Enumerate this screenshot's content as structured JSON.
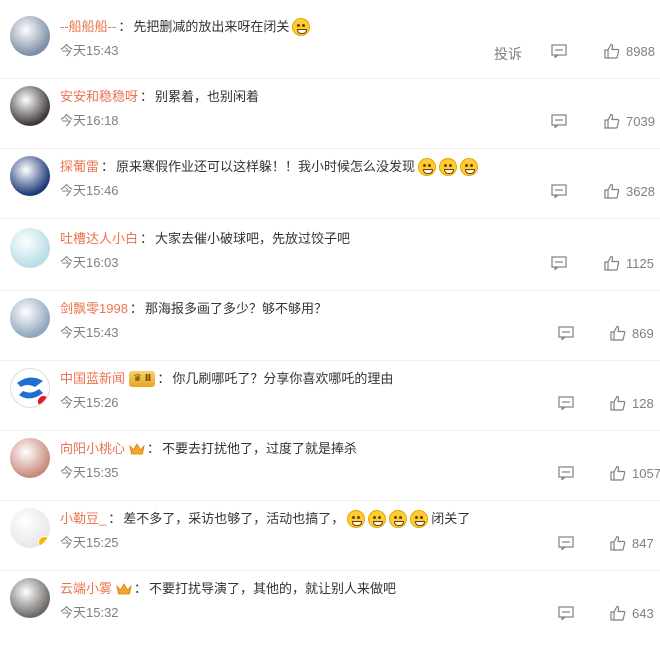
{
  "comments": [
    {
      "username": "--船船船--",
      "text": "先把删减的放出来呀在闭关",
      "time": "今天15:43",
      "likes": "8988",
      "report": "投诉",
      "emojis": 1,
      "avatar_color": "#7c8ea5"
    },
    {
      "username": "安安和稳稳呀",
      "text": "别累着，也别闲着",
      "time": "今天16:18",
      "likes": "7039",
      "emojis": 0,
      "avatar_color": "#3e3a38"
    },
    {
      "username": "探葡雷",
      "text": "原来寒假作业还可以这样躲！！我小时候怎么没发现",
      "time": "今天15:46",
      "likes": "3628",
      "emojis": 3,
      "avatar_color": "#1d3a7a"
    },
    {
      "username": "吐槽达人小白",
      "text": "大家去催小破球吧，先放过饺子吧",
      "time": "今天16:03",
      "likes": "1125",
      "emojis": 0,
      "avatar_color": "#b7dde6"
    },
    {
      "username": "剑飘零1998",
      "text": "那海报多画了多少？够不够用？",
      "time": "今天15:43",
      "likes": "869",
      "emojis": 0,
      "avatar_color": "#8fa6bd"
    },
    {
      "username": "中国蓝新闻",
      "badge": "Ⅱ",
      "text": "你几刷哪吒了？分享你喜欢哪吒的理由",
      "time": "今天15:26",
      "likes": "128",
      "emojis": 0,
      "avatar_color": "#ffffff",
      "verified": true
    },
    {
      "username": "向阳小桃心",
      "crown": true,
      "text": "不要去打扰他了，过度了就是捧杀",
      "time": "今天15:35",
      "likes": "1057",
      "emojis": 0,
      "avatar_color": "#c88a7c"
    },
    {
      "username": "小勒豆_",
      "text": "差不多了，采访也够了，活动也搞了，",
      "text_after": "闭关了",
      "time": "今天15:25",
      "likes": "847",
      "emojis": 4,
      "avatar_color": "#e7e7e7",
      "verified_gold": true
    },
    {
      "username": "云端小雾",
      "crown": true,
      "text": "不要打扰导演了，其他的，就让别人来做吧",
      "time": "今天15:32",
      "likes": "643",
      "emojis": 0,
      "avatar_color": "#6d6a66"
    }
  ],
  "colors": {
    "username": "#eb7350",
    "meta": "#808080",
    "text": "#333333"
  }
}
